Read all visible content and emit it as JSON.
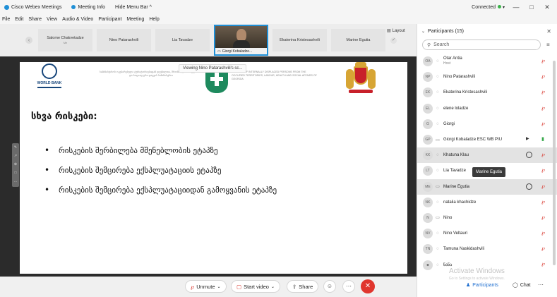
{
  "titlebar": {
    "app_name": "Cisco Webex Meetings",
    "meeting_info": "Meeting Info",
    "hide_menu": "Hide Menu Bar ^",
    "status": "Connected",
    "minimize": "—",
    "maximize": "□",
    "close": "✕"
  },
  "menu": {
    "file": "File",
    "edit": "Edit",
    "share": "Share",
    "view": "View",
    "audio_video": "Audio & Video",
    "participant": "Participant",
    "meeting": "Meeting",
    "help": "Help"
  },
  "strip": {
    "tiles": [
      {
        "name": "Salome Chakvetadze",
        "sub": "Me"
      },
      {
        "name": "Nino Patarashvili",
        "sub": ""
      },
      {
        "name": "Lia Tavadze",
        "sub": ""
      },
      {
        "name": "Ekaterina Kristesashvili",
        "sub": ""
      },
      {
        "name": "Marine Egutia",
        "sub": ""
      }
    ],
    "active_speaker": "Giorgi Kobaladze...",
    "layout_label": "Layout"
  },
  "share": {
    "viewing_label": "Viewing Nino Patarashvili's sc...",
    "wb_label": "WORLD BANK",
    "ministry_left": "სამინისტროს ოკუპირებული ტერიტორიებიდან დევნილთა, შრომის, ჯანმრთელობისა და სოციალური დაცვის სამინისტრო",
    "ministry_right": "MINISTRY OF INTERNALLY DISPLACED PERSONS FROM THE OCCUPIED TERRITORIES, LABOUR, HEALTH AND SOCIAL AFFAIRS OF GEORGIA",
    "heading": "სხვა რისკები:",
    "bullets": [
      "რისკების შერბილება მშენებლობის ეტაპზე",
      "რისკების შემცირება ექსპლუატაციის ეტაპზე",
      "რისკების შემცირება ექსპლუატაციიდან გამოყვანის ეტაპზე"
    ]
  },
  "controls": {
    "unmute": "Unmute",
    "start_video": "Start video",
    "share": "Share"
  },
  "panel": {
    "title": "Participants (15)",
    "search_placeholder": "Search",
    "participants": [
      {
        "initials": "OA",
        "name": "Otar Antia",
        "role": "Host",
        "status": "muted"
      },
      {
        "initials": "NP",
        "name": "Nino Patarashvili",
        "role": "",
        "status": "muted"
      },
      {
        "initials": "EK",
        "name": "Ekaterina Kristesashvili",
        "role": "",
        "status": "muted"
      },
      {
        "initials": "EL",
        "name": "elene loladze",
        "role": "",
        "status": "muted"
      },
      {
        "initials": "G",
        "name": "Giorgi",
        "role": "",
        "status": "muted"
      },
      {
        "initials": "GP",
        "name": "Giorgi Kobaladze ESC WB PIU",
        "role": "",
        "status": "live"
      },
      {
        "initials": "KK",
        "name": "Khatuna Klau",
        "role": "",
        "status": "muted"
      },
      {
        "initials": "LT",
        "name": "Lia Tavadze",
        "role": "",
        "status": "muted"
      },
      {
        "initials": "ME",
        "name": "Marine Egutia",
        "role": "",
        "status": "muted"
      },
      {
        "initials": "NK",
        "name": "natalia khachidze",
        "role": "",
        "status": "muted"
      },
      {
        "initials": "N",
        "name": "Nino",
        "role": "",
        "status": "muted"
      },
      {
        "initials": "NV",
        "name": "Nino Veltauri",
        "role": "",
        "status": "muted"
      },
      {
        "initials": "TN",
        "name": "Tamuna Naskidashvili",
        "role": "",
        "status": "muted"
      },
      {
        "initials": "",
        "name": "ნანა",
        "role": "",
        "status": "muted"
      }
    ],
    "tooltip": "Marine Egutia",
    "activate_title": "Activate Windows",
    "activate_sub": "Go to Settings to activate Windows.",
    "footer_participants": "Participants",
    "footer_chat": "Chat"
  }
}
